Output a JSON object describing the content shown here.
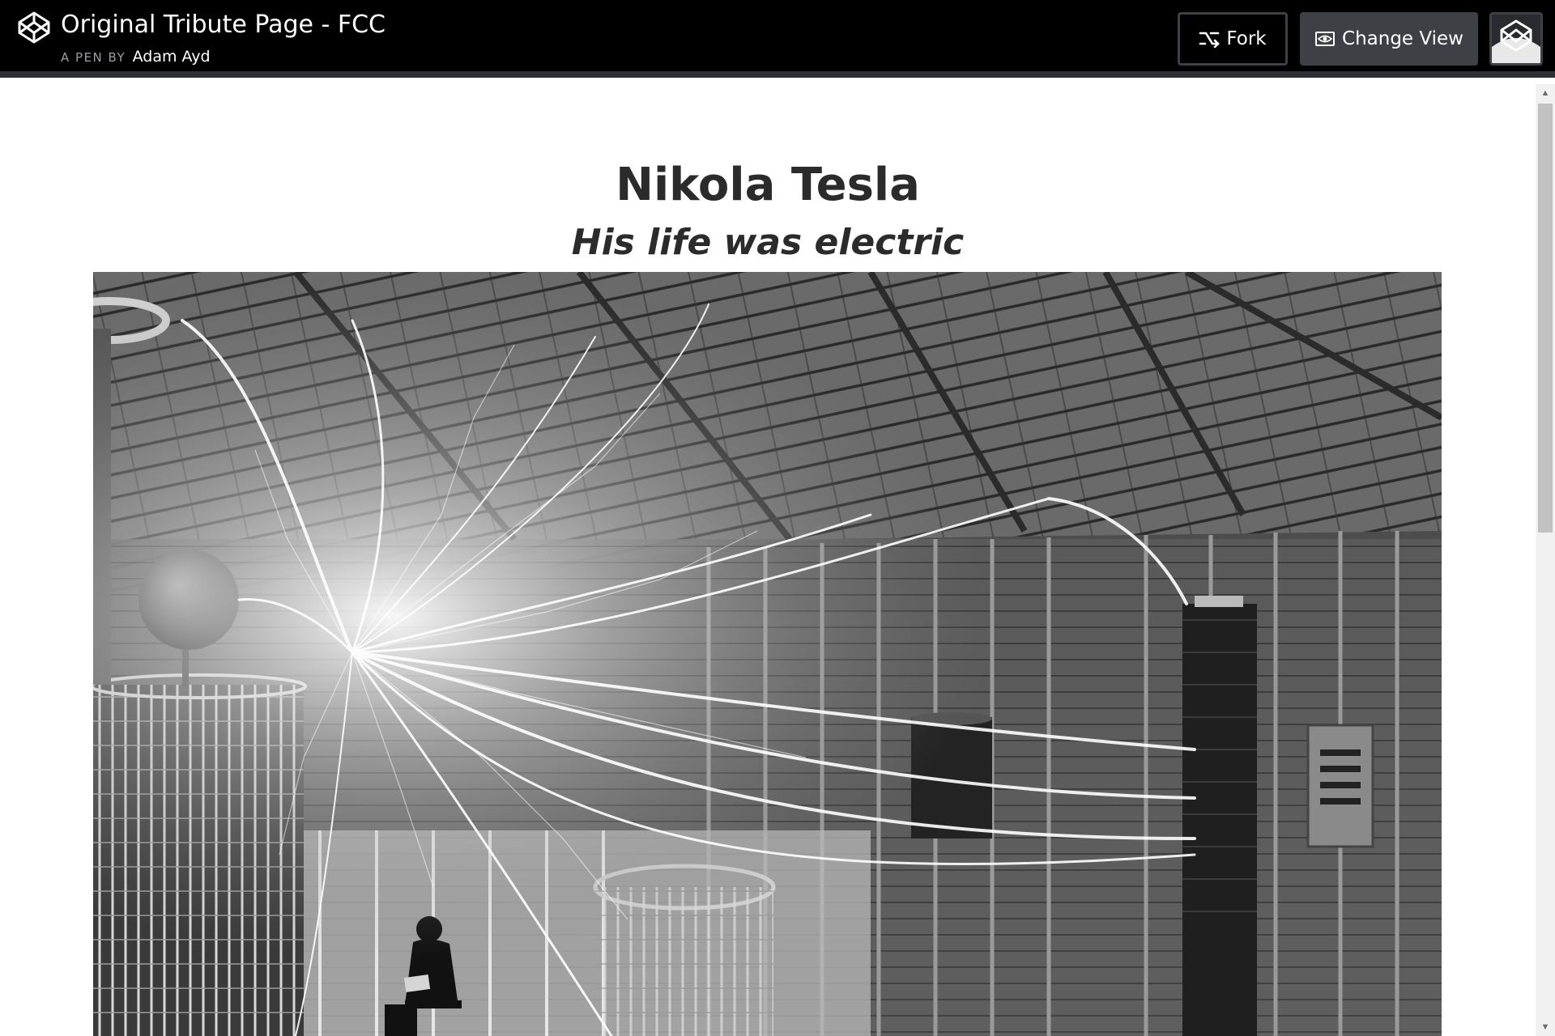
{
  "topbar": {
    "title": "Original Tribute Page - FCC",
    "byline_prefix": "A PEN BY",
    "author": "Adam Ayd",
    "fork_label": "Fork",
    "change_view_label": "Change View",
    "logo_icon": "codepen-logo-icon",
    "fork_icon": "fork-icon",
    "view_icon": "eye-icon",
    "background": "#000000",
    "button_color": "#3f4046"
  },
  "page": {
    "heading": "Nikola Tesla",
    "subheading": "His life was electric",
    "image_subject": "Nikola Tesla seated in his laboratory beneath huge electrical discharges"
  },
  "scrollbar": {
    "up_icon": "scroll-up-arrow-icon",
    "down_icon": "scroll-down-arrow-icon"
  }
}
